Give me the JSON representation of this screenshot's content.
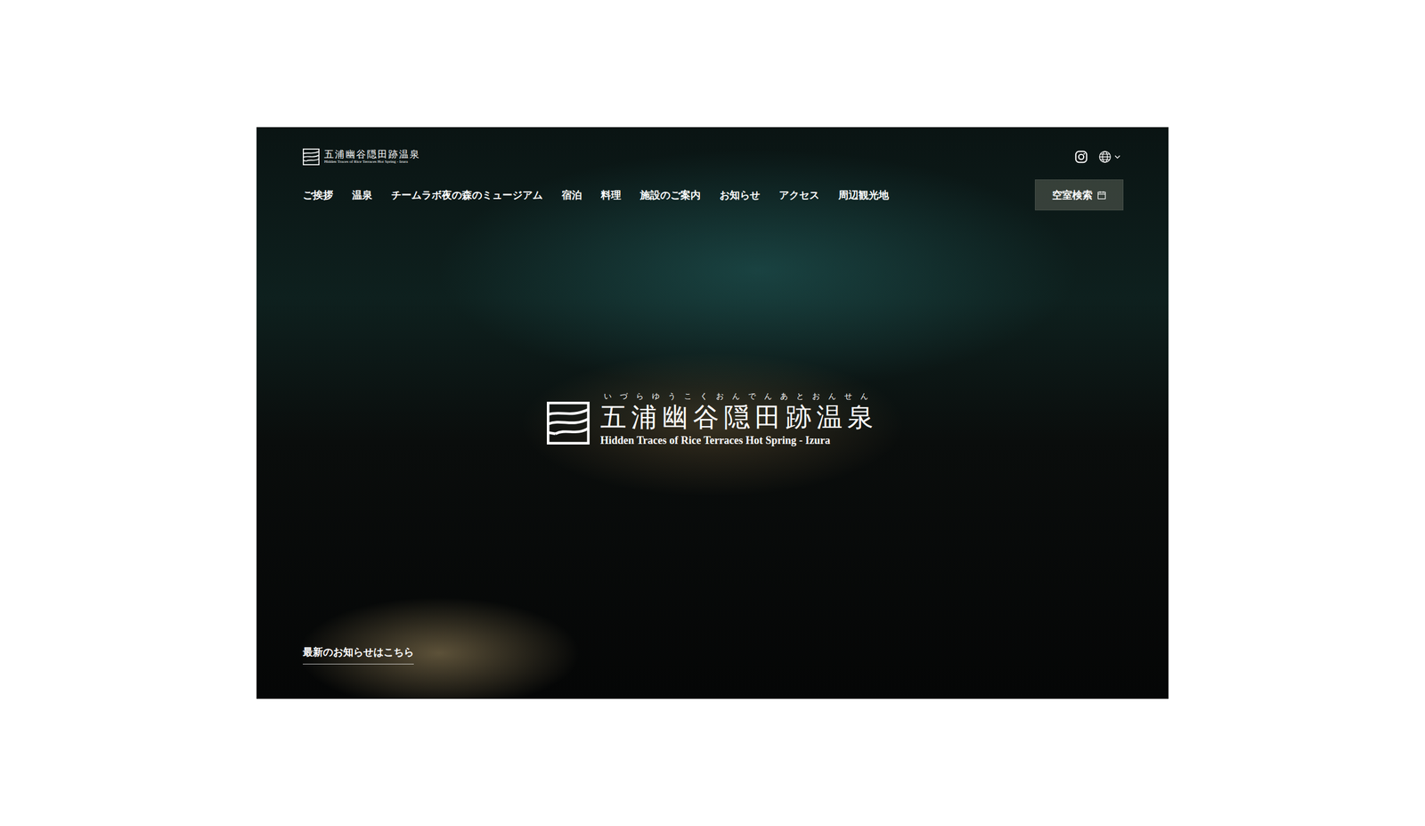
{
  "logo": {
    "title": "五浦幽谷隠田跡温泉",
    "subtitle": "Hidden Traces of Rice Terraces Hot Spring - Izura"
  },
  "nav": [
    {
      "label": "ご挨拶"
    },
    {
      "label": "温泉"
    },
    {
      "label": "チームラボ夜の森のミュージアム"
    },
    {
      "label": "宿泊"
    },
    {
      "label": "料理"
    },
    {
      "label": "施設のご案内"
    },
    {
      "label": "お知らせ"
    },
    {
      "label": "アクセス"
    },
    {
      "label": "周辺観光地"
    }
  ],
  "reserve_button": {
    "label": "空室検索"
  },
  "hero": {
    "ruby": "いづらゆうこくおんでんあとおんせん",
    "title": "五浦幽谷隠田跡温泉",
    "subtitle": "Hidden Traces of Rice Terraces Hot Spring - Izura"
  },
  "news_link": "最新のお知らせはこちら"
}
